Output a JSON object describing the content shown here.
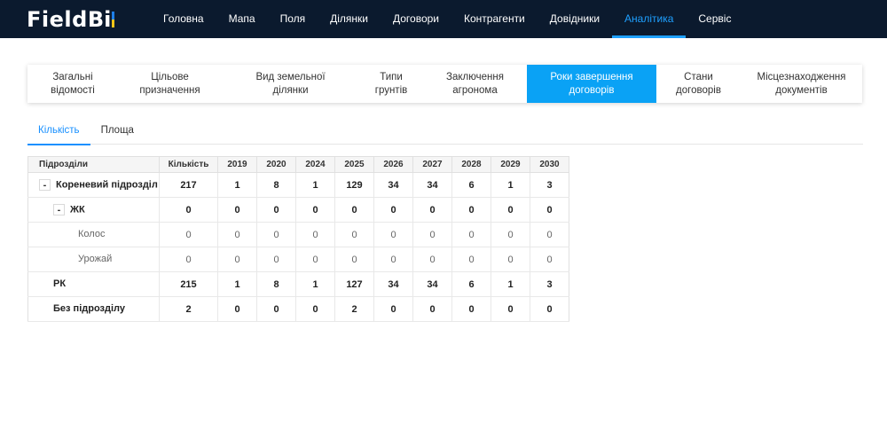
{
  "brand": {
    "field": "Field",
    "bi": "Bi"
  },
  "nav": [
    {
      "label": "Головна",
      "active": false
    },
    {
      "label": "Мапа",
      "active": false
    },
    {
      "label": "Поля",
      "active": false
    },
    {
      "label": "Ділянки",
      "active": false
    },
    {
      "label": "Договори",
      "active": false
    },
    {
      "label": "Контрагенти",
      "active": false
    },
    {
      "label": "Довідники",
      "active": false
    },
    {
      "label": "Аналітика",
      "active": true
    },
    {
      "label": "Сервіс",
      "active": false
    }
  ],
  "cards": [
    {
      "line1": "Загальні",
      "line2": "відомості",
      "active": false
    },
    {
      "line1": "Цільове",
      "line2": "призначення",
      "active": false
    },
    {
      "line1": "Вид земельної",
      "line2": "ділянки",
      "active": false
    },
    {
      "line1": "Типи",
      "line2": "грунтів",
      "active": false
    },
    {
      "line1": "Заключення",
      "line2": "агронома",
      "active": false
    },
    {
      "line1": "Роки завершення",
      "line2": "договорів",
      "active": true
    },
    {
      "line1": "Стани",
      "line2": "договорів",
      "active": false
    },
    {
      "line1": "Місцезнаходження",
      "line2": "документів",
      "active": false
    }
  ],
  "subtabs": [
    {
      "label": "Кількість",
      "active": true
    },
    {
      "label": "Площа",
      "active": false
    }
  ],
  "table": {
    "headers": [
      "Підрозділи",
      "Кількість",
      "2019",
      "2020",
      "2024",
      "2025",
      "2026",
      "2027",
      "2028",
      "2029",
      "2030"
    ],
    "rows": [
      {
        "name": "Кореневий підрозділ",
        "toggle": "-",
        "indent": 0,
        "style": "bold",
        "values": [
          "217",
          "1",
          "8",
          "1",
          "129",
          "34",
          "34",
          "6",
          "1",
          "3"
        ]
      },
      {
        "name": "ЖК",
        "toggle": "-",
        "indent": 1,
        "style": "bold",
        "values": [
          "0",
          "0",
          "0",
          "0",
          "0",
          "0",
          "0",
          "0",
          "0",
          "0"
        ]
      },
      {
        "name": "Колос",
        "toggle": "",
        "indent": 2,
        "style": "light",
        "values": [
          "0",
          "0",
          "0",
          "0",
          "0",
          "0",
          "0",
          "0",
          "0",
          "0"
        ]
      },
      {
        "name": "Урожай",
        "toggle": "",
        "indent": 2,
        "style": "light",
        "values": [
          "0",
          "0",
          "0",
          "0",
          "0",
          "0",
          "0",
          "0",
          "0",
          "0"
        ]
      },
      {
        "name": "РК",
        "toggle": "",
        "indent": 1,
        "style": "bold",
        "values": [
          "215",
          "1",
          "8",
          "1",
          "127",
          "34",
          "34",
          "6",
          "1",
          "3"
        ]
      },
      {
        "name": "Без підрозділу",
        "toggle": "",
        "indent": 1,
        "style": "bold",
        "values": [
          "2",
          "0",
          "0",
          "0",
          "2",
          "0",
          "0",
          "0",
          "0",
          "0"
        ]
      }
    ]
  },
  "colors": {
    "nav_bg": "#0b1a2e",
    "accent": "#1ea0ff",
    "active_card": "#0aa2f5"
  }
}
